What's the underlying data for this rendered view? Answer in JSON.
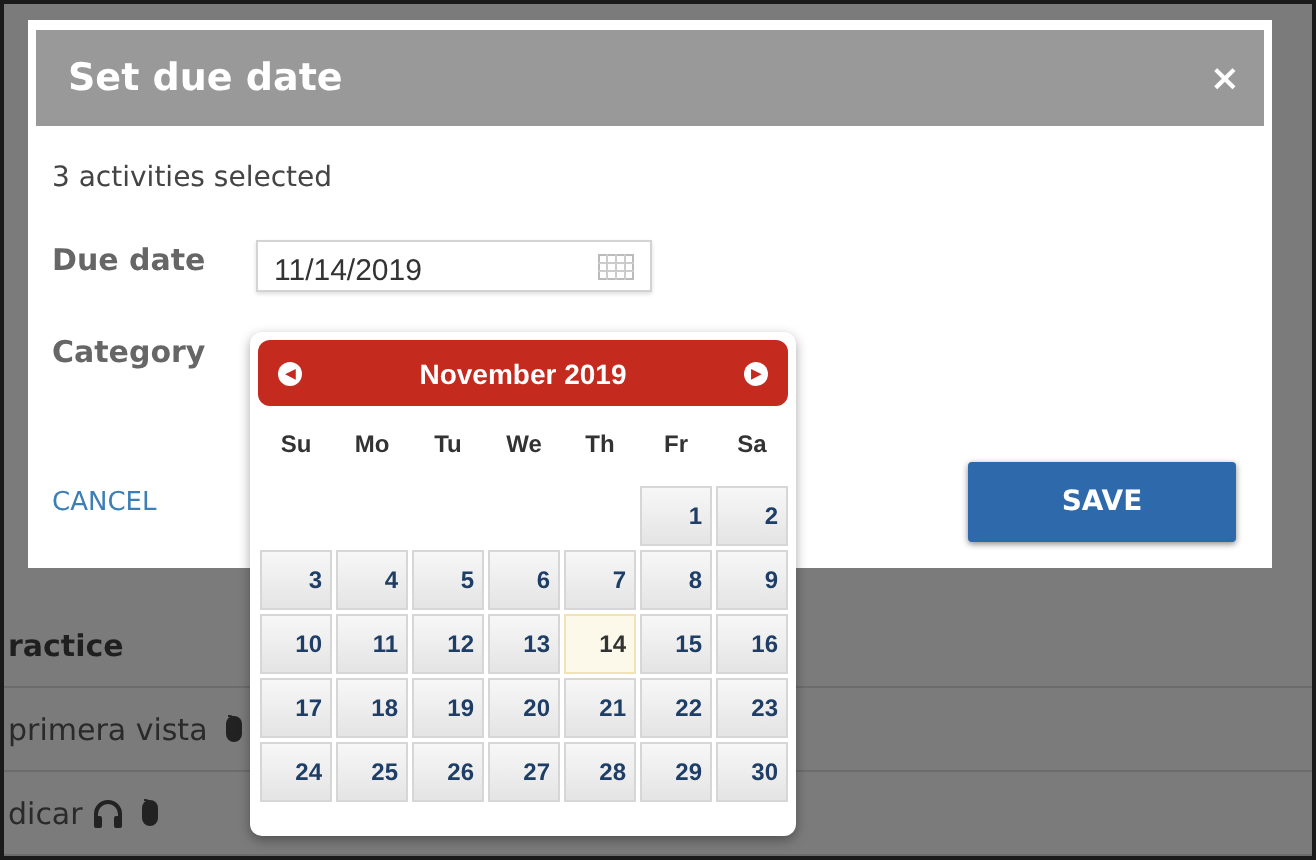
{
  "background": {
    "rows": [
      {
        "kind": "heading",
        "text": "ractice"
      },
      {
        "kind": "item",
        "text": "primera vista"
      },
      {
        "kind": "audio-item",
        "text": "dicar"
      }
    ]
  },
  "dialog": {
    "title": "Set due date",
    "close": "×",
    "summary": "3 activities selected",
    "fields": [
      {
        "kind": "date",
        "label": "Due date",
        "value": "11/14/2019"
      },
      {
        "kind": "select",
        "label": "Category"
      }
    ],
    "cancel": "CANCEL",
    "save": "SAVE"
  },
  "calendar": {
    "month": "November 2019",
    "prev": "◀",
    "next": "▶",
    "weekdays": [
      "Su",
      "Mo",
      "Tu",
      "We",
      "Th",
      "Fr",
      "Sa"
    ],
    "weeks": [
      [
        {
          "label": "1",
          "selected": false
        },
        {
          "label": "2",
          "selected": false
        }
      ],
      [
        {
          "label": "3",
          "selected": false
        },
        {
          "label": "4",
          "selected": false
        },
        {
          "label": "5",
          "selected": false
        },
        {
          "label": "6",
          "selected": false
        },
        {
          "label": "7",
          "selected": false
        },
        {
          "label": "8",
          "selected": false
        },
        {
          "label": "9",
          "selected": false
        }
      ],
      [
        {
          "label": "10",
          "selected": false
        },
        {
          "label": "11",
          "selected": false
        },
        {
          "label": "12",
          "selected": false
        },
        {
          "label": "13",
          "selected": false
        },
        {
          "label": "14",
          "selected": true
        },
        {
          "label": "15",
          "selected": false
        },
        {
          "label": "16",
          "selected": false
        }
      ],
      [
        {
          "label": "17",
          "selected": false
        },
        {
          "label": "18",
          "selected": false
        },
        {
          "label": "19",
          "selected": false
        },
        {
          "label": "20",
          "selected": false
        },
        {
          "label": "21",
          "selected": false
        },
        {
          "label": "22",
          "selected": false
        },
        {
          "label": "23",
          "selected": false
        }
      ],
      [
        {
          "label": "24",
          "selected": false
        },
        {
          "label": "25",
          "selected": false
        },
        {
          "label": "26",
          "selected": false
        },
        {
          "label": "27",
          "selected": false
        },
        {
          "label": "28",
          "selected": false
        },
        {
          "label": "29",
          "selected": false
        },
        {
          "label": "30",
          "selected": false
        }
      ]
    ]
  }
}
